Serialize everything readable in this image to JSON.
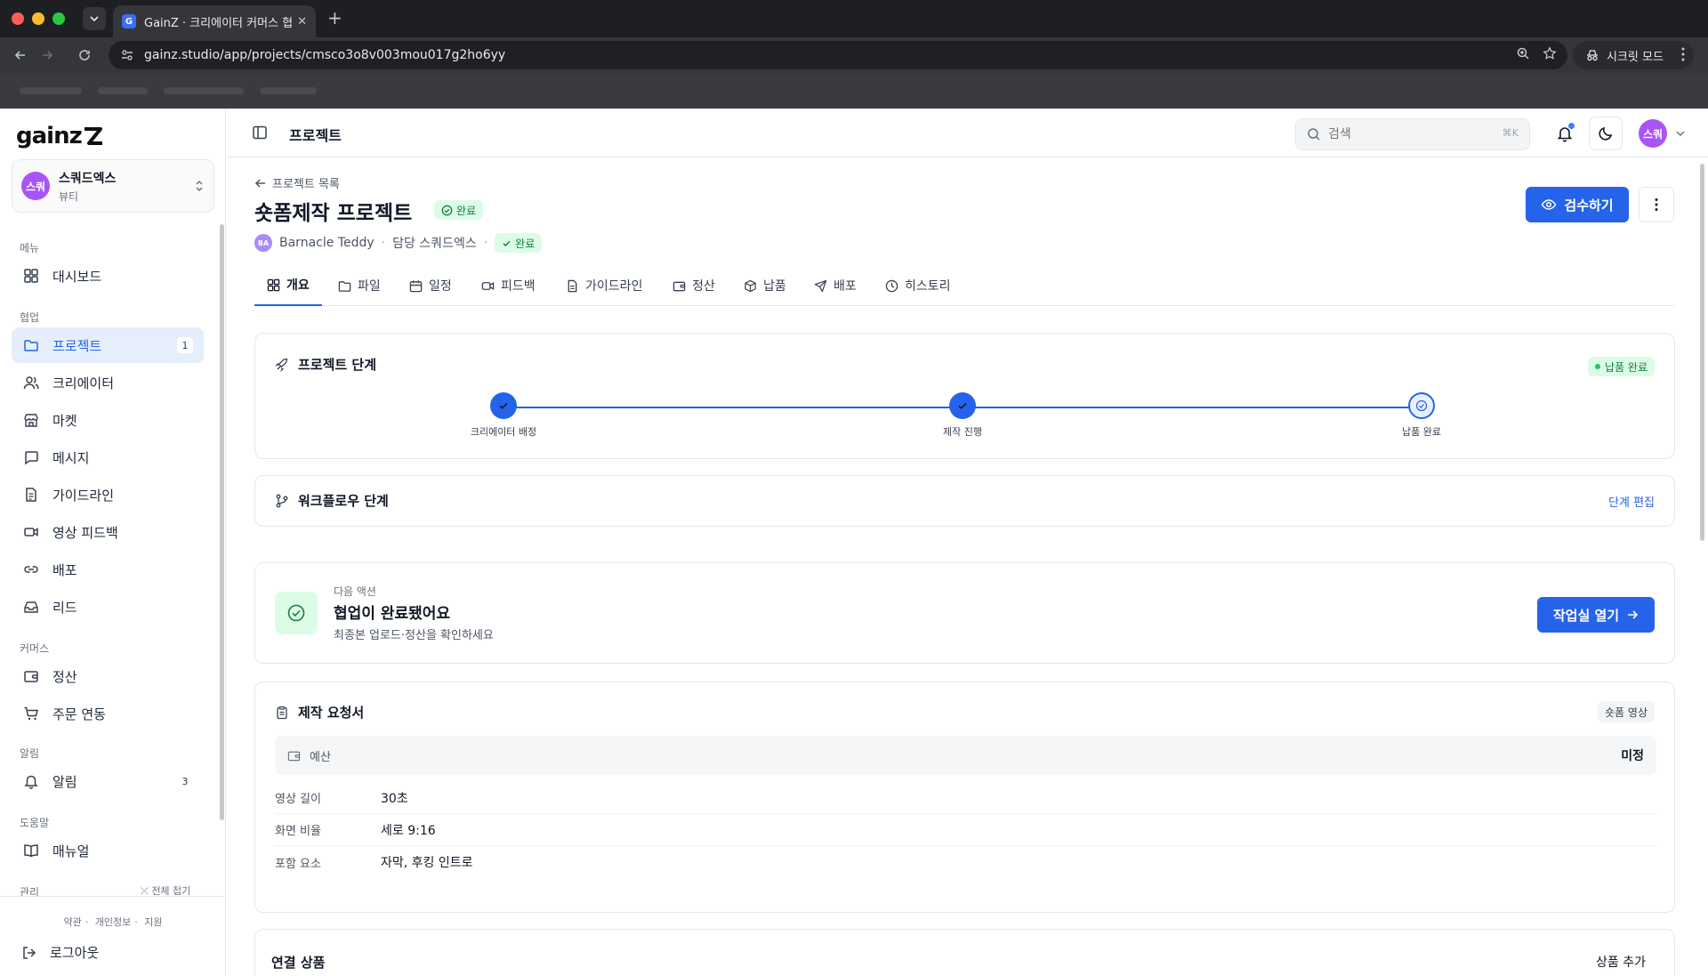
{
  "browser": {
    "tab_title": "GainZ · 크리에이터 커머스 협업 O",
    "favicon_letter": "G",
    "url": "gainz.studio/app/projects/cmsco3o8v003mou017g2ho6yy",
    "incognito_label": "시크릿 모드"
  },
  "sidebar": {
    "logo": "gainz",
    "workspace": {
      "avatar": "스쿼",
      "name": "스쿼드엑스",
      "category": "뷰티"
    },
    "sections": {
      "menu": "메뉴",
      "collab": "협업",
      "commerce": "커머스",
      "alerts": "알림",
      "help": "도움말",
      "admin": "관리"
    },
    "items": {
      "dashboard": "대시보드",
      "projects": "프로젝트",
      "projects_count": "1",
      "creators": "크리에이터",
      "market": "마켓",
      "messages": "메시지",
      "guidelines": "가이드라인",
      "video_feedback": "영상 피드백",
      "distribution": "배포",
      "leads": "리드",
      "settlement": "정산",
      "order_sync": "주문 연동",
      "notifications": "알림",
      "notifications_count": "3",
      "manual": "매뉴얼"
    },
    "collapse_all": "전체 접기",
    "footer": {
      "terms": "약관",
      "privacy": "개인정보",
      "support": "지원",
      "logout": "로그아웃"
    }
  },
  "header": {
    "title": "프로젝트",
    "search_placeholder": "검색",
    "search_shortcut": "⌘K",
    "user_avatar": "스쿼"
  },
  "project": {
    "back_label": "프로젝트 목록",
    "title": "숏폼제작 프로젝트",
    "status": "완료",
    "creator_avatar": "BA",
    "creator_name": "Barnacle Teddy",
    "manager": "담당 스쿼드엑스",
    "meta_status": "완료",
    "review_button": "검수하기",
    "tabs": [
      "개요",
      "파일",
      "일정",
      "피드백",
      "가이드라인",
      "정산",
      "납품",
      "배포",
      "히스토리"
    ]
  },
  "stages": {
    "title": "프로젝트 단계",
    "badge": "납품 완료",
    "steps": [
      "크리에이터 배정",
      "제작 진행",
      "납품 완료"
    ]
  },
  "workflow": {
    "title": "워크플로우 단계",
    "edit": "단계 편집"
  },
  "next_action": {
    "eyebrow": "다음 액션",
    "title": "협업이 완료됐어요",
    "subtitle": "최종본 업로드·정산을 확인하세요",
    "button": "작업실 열기"
  },
  "brief": {
    "title": "제작 요청서",
    "type_badge": "숏폼 영상",
    "budget_label": "예산",
    "budget_value": "미정",
    "rows": [
      {
        "label": "영상 길이",
        "value": "30초"
      },
      {
        "label": "화면 비율",
        "value": "세로 9:16"
      },
      {
        "label": "포함 요소",
        "value": "자막, 후킹 인트로"
      }
    ]
  },
  "linked": {
    "title": "연결 상품",
    "add": "상품 추가"
  }
}
